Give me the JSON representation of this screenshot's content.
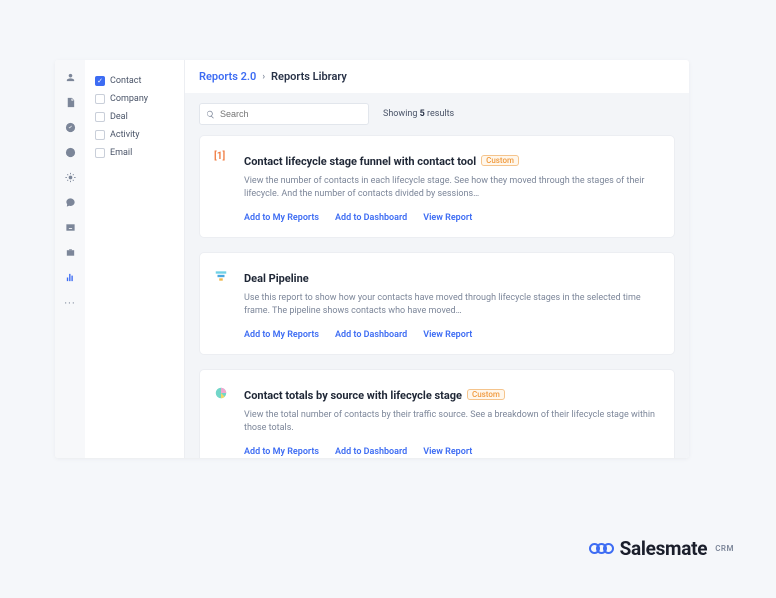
{
  "breadcrumb": {
    "link": "Reports 2.0",
    "current": "Reports Library"
  },
  "search": {
    "placeholder": "Search"
  },
  "results": {
    "prefix": "Showing ",
    "count": "5",
    "suffix": " results"
  },
  "filters": [
    {
      "label": "Contact",
      "checked": true
    },
    {
      "label": "Company",
      "checked": false
    },
    {
      "label": "Deal",
      "checked": false
    },
    {
      "label": "Activity",
      "checked": false
    },
    {
      "label": "Email",
      "checked": false
    }
  ],
  "actions": {
    "addMyReports": "Add to My Reports",
    "addDashboard": "Add to Dashboard",
    "viewReport": "View Report"
  },
  "badge_custom": "Custom",
  "reports": [
    {
      "icon": "number-one",
      "title": "Contact lifecycle stage funnel with contact tool",
      "badge": true,
      "desc": "View the number of contacts in each lifecycle stage. See how they moved through the stages of their lifecycle. And the number of contacts divided by sessions…"
    },
    {
      "icon": "funnel",
      "title": "Deal Pipeline",
      "badge": false,
      "desc": "Use this report to show how your contacts have moved through lifecycle stages in the selected time frame. The pipeline shows contacts who have moved…"
    },
    {
      "icon": "pie",
      "title": "Contact totals by source with lifecycle stage",
      "badge": true,
      "desc": "View the total number of contacts by their traffic source. See a breakdown of their lifecycle stage within those totals."
    }
  ],
  "brand": {
    "name": "Salesmate",
    "suffix": "CRM"
  }
}
